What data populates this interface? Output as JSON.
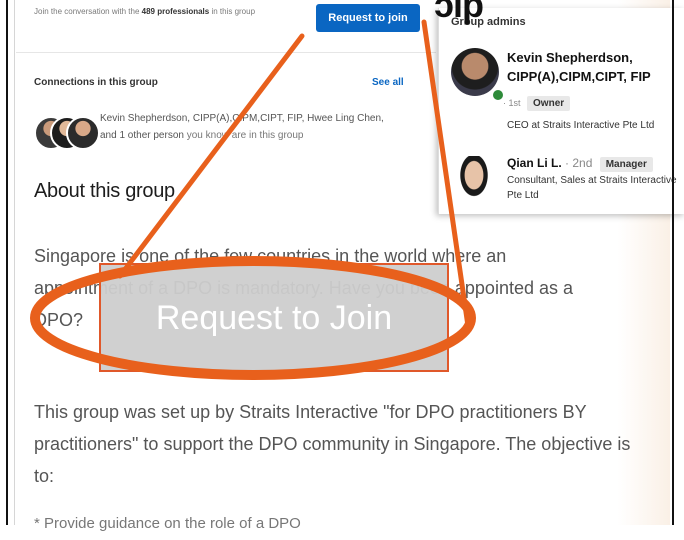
{
  "join_banner": {
    "text_prefix": "Join the conversation with the ",
    "count": "489 professionals",
    "text_suffix": " in this group",
    "button_label": "Request to join"
  },
  "connections": {
    "title": "Connections in this group",
    "see_all": "See all",
    "names": "Kevin Shepherdson, CIPP(A),CIPM,CIPT, FIP, Hwee Ling Chen, and 1 other person",
    "suffix": " you know are in this group"
  },
  "about": {
    "title": "About this group",
    "paragraph1": "Singapore is one of the few countries in the world where an appointment of a DPO is mandatory. Have you been appointed as a DPO?",
    "paragraph2": "This group was set up by Straits Interactive \"for DPO practitioners BY practitioners\" to support the DPO community in Singapore. The objective is to:",
    "bullet1": "* Provide guidance on the role of a DPO"
  },
  "admins": {
    "title": "Group admins",
    "items": [
      {
        "name": "Kevin Shepherdson, CIPP(A),CIPM,CIPT, FIP",
        "degree": "· 1st",
        "role": "Owner",
        "headline": "CEO at Straits Interactive Pte Ltd"
      },
      {
        "name": "Qian Li L.",
        "degree": "· 2nd",
        "role": "Manager",
        "headline": "Consultant, Sales at Straits Interactive Pte Ltd"
      }
    ]
  },
  "logo_fragment": "ɔip",
  "overlay": {
    "label": "Request to Join",
    "accent_color": "#e8601c"
  }
}
